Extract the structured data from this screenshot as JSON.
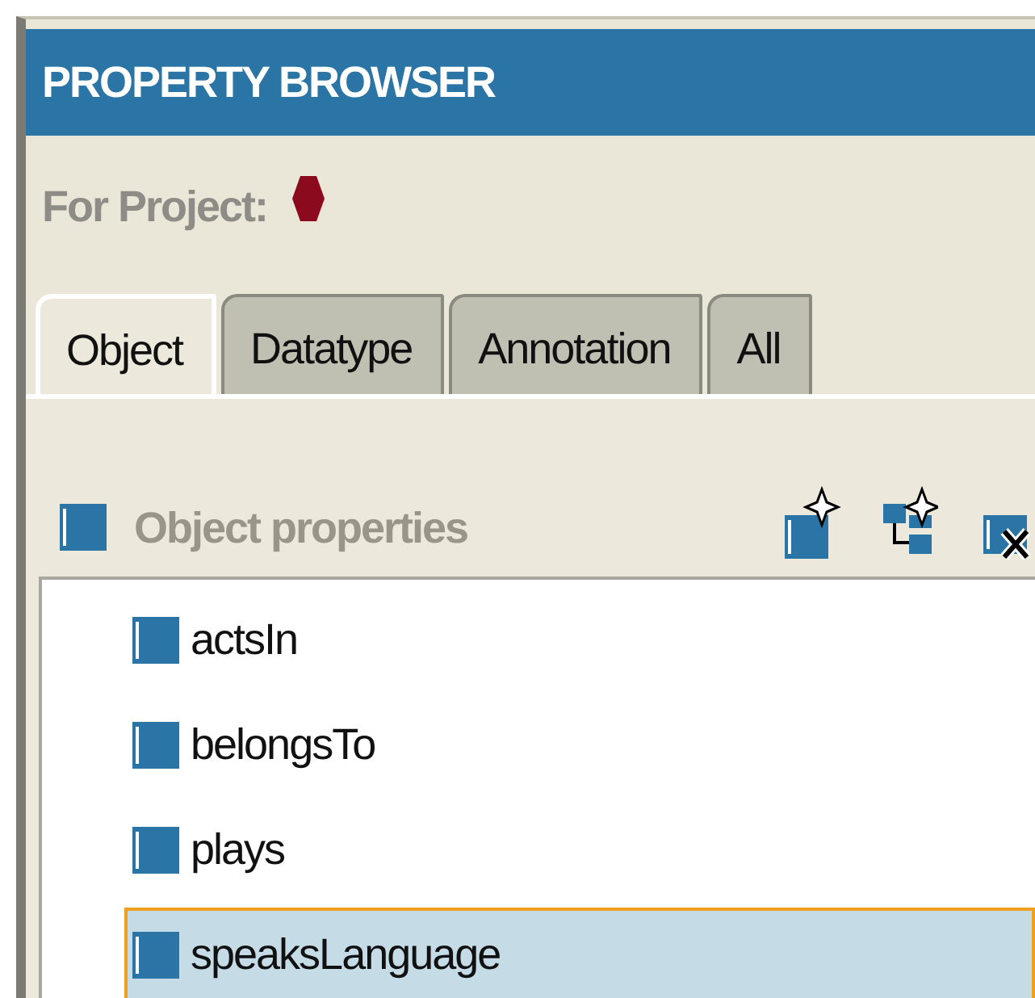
{
  "panel": {
    "title": "PROPERTY BROWSER",
    "project_label": "For Project:"
  },
  "tabs": [
    {
      "label": "Object",
      "selected": true
    },
    {
      "label": "Datatype",
      "selected": false
    },
    {
      "label": "Annotation",
      "selected": false
    },
    {
      "label": "All",
      "selected": false
    }
  ],
  "section": {
    "title": "Object properties"
  },
  "properties": [
    {
      "name": "actsIn",
      "selected": false
    },
    {
      "name": "belongsTo",
      "selected": false
    },
    {
      "name": "plays",
      "selected": false
    },
    {
      "name": "speaksLanguage",
      "selected": true
    }
  ]
}
